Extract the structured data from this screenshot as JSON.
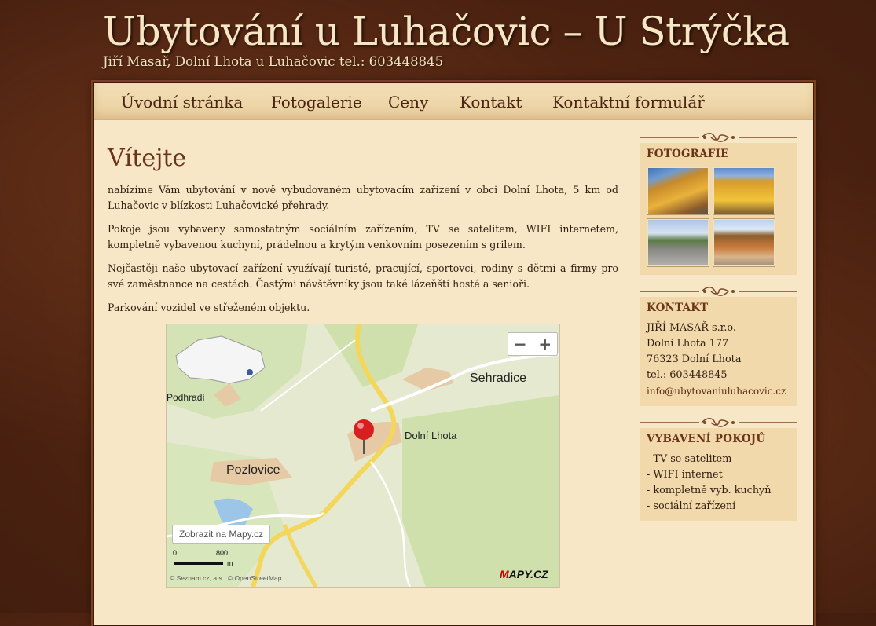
{
  "header": {
    "title": "Ubytování u Luhačovic – U Strýčka",
    "subtitle": "Jiří Masař, Dolní Lhota u Luhačovic tel.: 603448845"
  },
  "nav": [
    {
      "label": "Úvodní stránka"
    },
    {
      "label": "Fotogalerie"
    },
    {
      "label": "Ceny"
    },
    {
      "label": "Kontakt"
    },
    {
      "label": "Kontaktní formulář"
    }
  ],
  "main": {
    "heading": "Vítejte",
    "paragraphs": [
      "nabízíme Vám ubytování v nově vybudovaném ubytovacím zařízení v obci Dolní Lhota, 5 km od Luhačovic v blízkosti Luhačovické přehrady.",
      "Pokoje jsou vybaveny samostatným sociálním zařízením, TV se satelitem, WIFI internetem, kompletně vybavenou kuchyní, prádelnou a krytým venkovním posezením s grilem.",
      "Nejčastěji naše ubytovací zařízení využívají turisté, pracující, sportovci, rodiny s dětmi a firmy pro své zaměstnance na cestách. Častými návštěvníky jsou také lázeňští hosté a senioři.",
      "Parkování vozidel ve střeženém objektu."
    ]
  },
  "map": {
    "zoom_out": "−",
    "zoom_in": "+",
    "places": [
      "Sehradice",
      "Dolní Lhota",
      "Pozlovice",
      "Podhradí"
    ],
    "open_button": "Zobrazit na Mapy.cz",
    "scale_start": "0",
    "scale_end": "800",
    "scale_unit": "m",
    "attribution": "© Seznam.cz, a.s., © OpenStreetMap",
    "logo_m": "M",
    "logo_rest": "APY.CZ"
  },
  "sidebar": {
    "photos": {
      "title": "FOTOGRAFIE"
    },
    "contact": {
      "title": "KONTAKT",
      "lines": [
        "JIŘÍ MASAŘ s.r.o.",
        "Dolní Lhota 177",
        "76323 Dolní Lhota",
        "tel.: 603448845"
      ],
      "email": "info@ubytovaniuluhacovic.cz"
    },
    "equipment": {
      "title": "VYBAVENÍ POKOJŮ",
      "items": [
        "- TV se satelitem",
        "- WIFI internet",
        "- kompletně vyb. kuchyň",
        "- sociální zařízení"
      ]
    }
  }
}
